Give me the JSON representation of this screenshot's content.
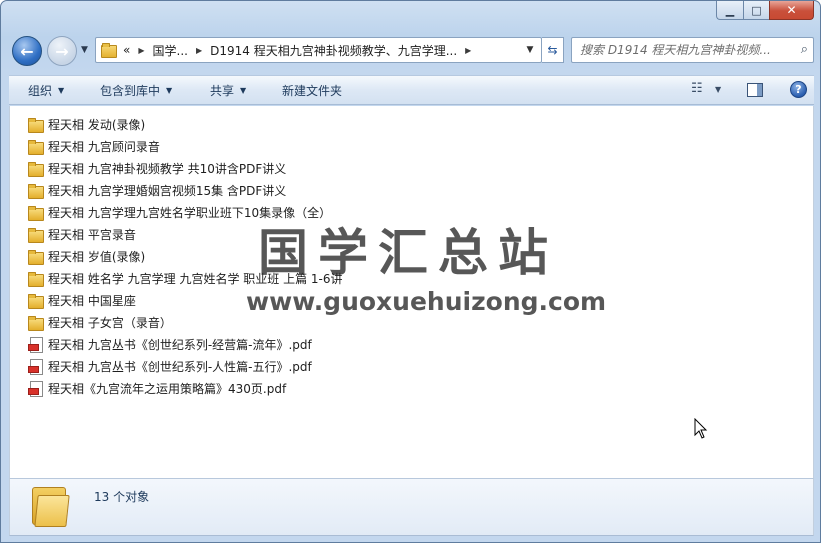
{
  "address": {
    "segments": [
      "国学...",
      "D1914 程天相九宫神卦视频教学、九宫学理..."
    ],
    "overflow_glyph": "«"
  },
  "search": {
    "placeholder": "搜索 D1914 程天相九宫神卦视频..."
  },
  "toolbar": {
    "organize": "组织",
    "include_in_library": "包含到库中",
    "share": "共享",
    "new_folder": "新建文件夹"
  },
  "files": [
    {
      "name": "程天相 发动(录像)",
      "type": "folder"
    },
    {
      "name": "程天相 九宫顾问录音",
      "type": "folder"
    },
    {
      "name": "程天相 九宫神卦视频教学 共10讲含PDF讲义",
      "type": "folder"
    },
    {
      "name": "程天相 九宫学理婚姻宫视频15集 含PDF讲义",
      "type": "folder"
    },
    {
      "name": "程天相 九宫学理九宫姓名学职业班下10集录像（全）",
      "type": "folder"
    },
    {
      "name": "程天相 平宫录音",
      "type": "folder"
    },
    {
      "name": "程天相 岁值(录像)",
      "type": "folder"
    },
    {
      "name": "程天相 姓名学 九宫学理 九宫姓名学 职业班 上篇 1-6讲",
      "type": "folder"
    },
    {
      "name": "程天相 中国星座",
      "type": "folder"
    },
    {
      "name": "程天相 子女宫（录音）",
      "type": "folder"
    },
    {
      "name": "程天相 九宫丛书《创世纪系列-经营篇-流年》.pdf",
      "type": "pdf"
    },
    {
      "name": "程天相 九宫丛书《创世纪系列-人性篇-五行》.pdf",
      "type": "pdf"
    },
    {
      "name": "程天相《九宫流年之运用策略篇》430页.pdf",
      "type": "pdf"
    }
  ],
  "watermark": {
    "title": "国学汇总站",
    "url": "www.guoxuehuizong.com"
  },
  "details": {
    "item_count": "13 个对象"
  },
  "colors": {
    "accent": "#2f6fc4",
    "folder": "#e3af2c",
    "pdf": "#d8312a"
  }
}
